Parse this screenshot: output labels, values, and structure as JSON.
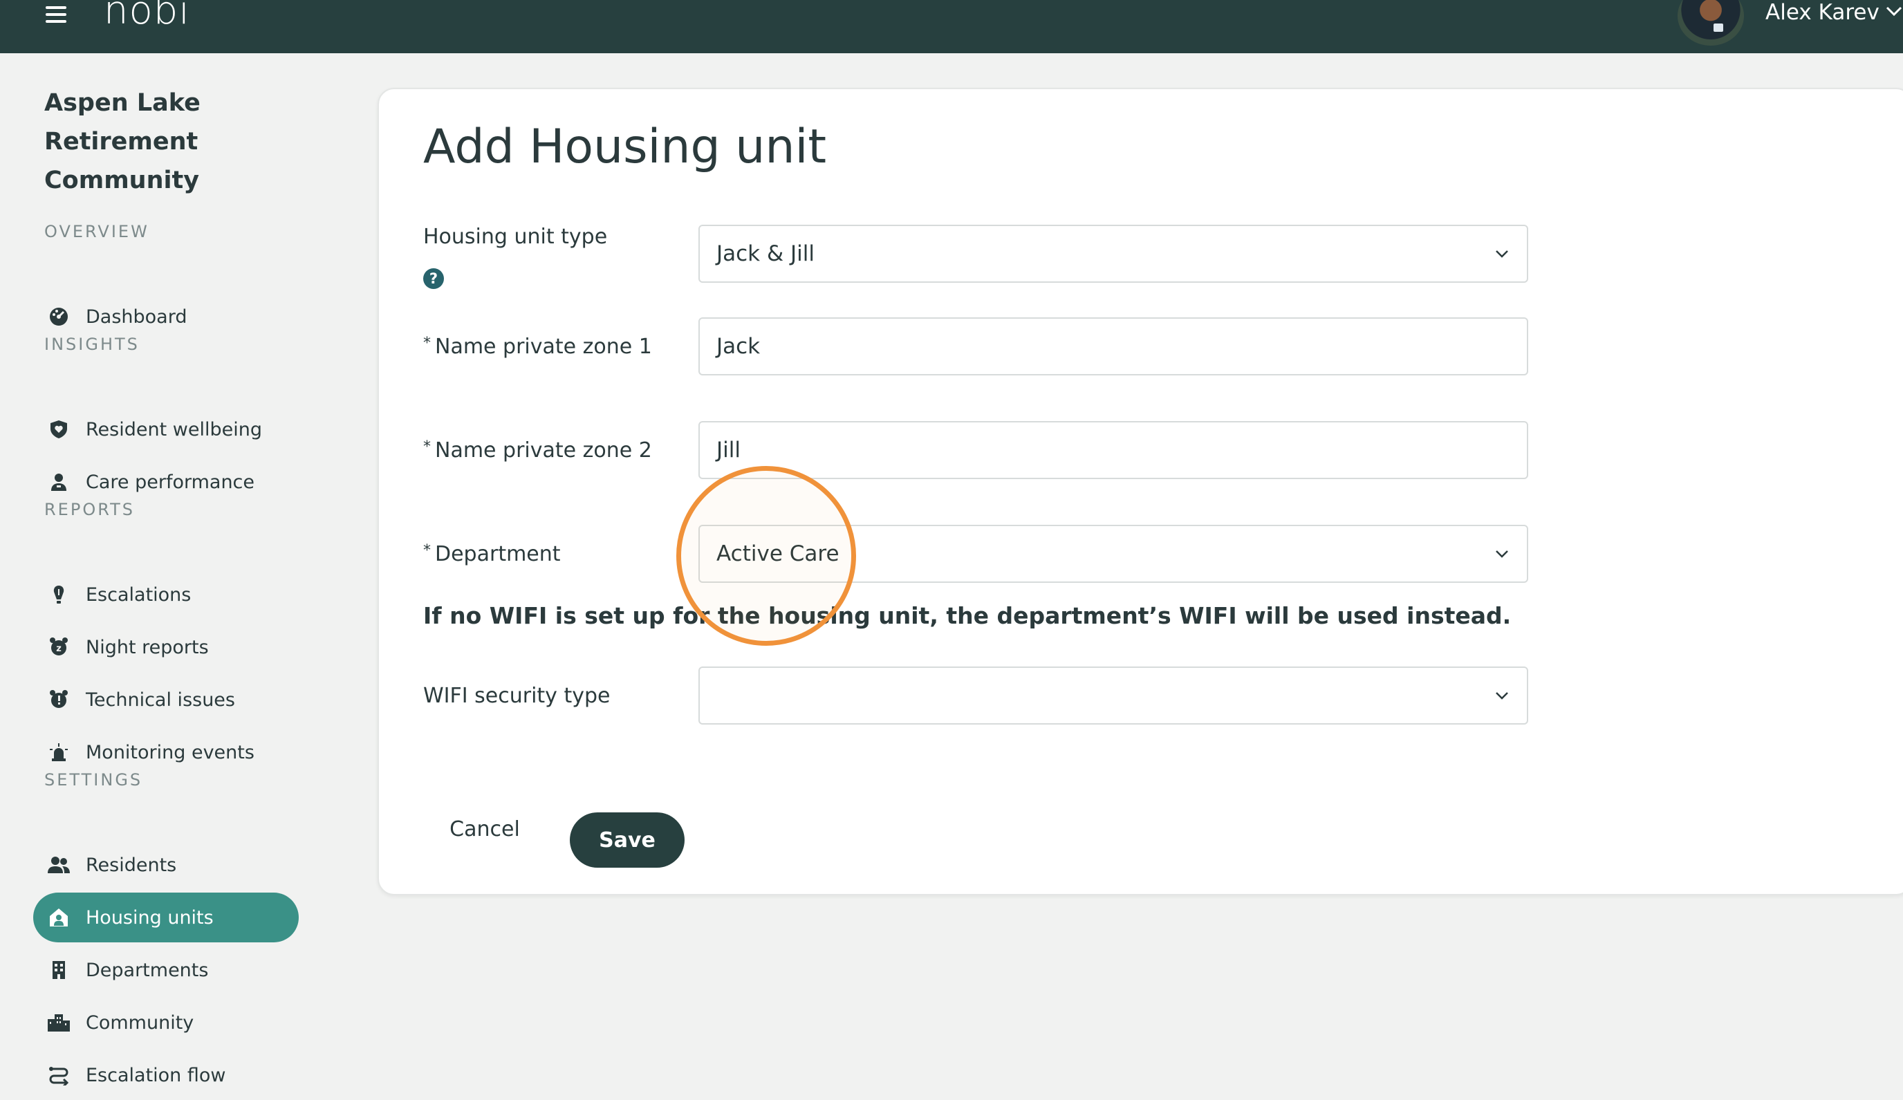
{
  "app": {
    "logo": "nobi"
  },
  "user": {
    "name": "Alex Karev"
  },
  "sidebar": {
    "community_name": "Aspen Lake Retirement Community",
    "sections": {
      "overview": "OVERVIEW",
      "insights": "INSIGHTS",
      "reports": "REPORTS",
      "settings": "SETTINGS"
    },
    "items": {
      "dashboard": "Dashboard",
      "resident_wellbeing": "Resident wellbeing",
      "care_performance": "Care performance",
      "escalations": "Escalations",
      "night_reports": "Night reports",
      "technical_issues": "Technical issues",
      "monitoring_events": "Monitoring events",
      "residents": "Residents",
      "housing_units": "Housing units",
      "departments": "Departments",
      "community": "Community",
      "escalation_flow": "Escalation flow"
    },
    "active_item": "housing_units"
  },
  "form": {
    "title": "Add Housing unit",
    "housing_unit_type": {
      "label": "Housing unit type",
      "value": "Jack & Jill",
      "help": "?"
    },
    "zone1": {
      "required_mark": "*",
      "label": "Name private zone 1",
      "value": "Jack"
    },
    "zone2": {
      "required_mark": "*",
      "label": "Name private zone 2",
      "value": "Jill"
    },
    "department": {
      "required_mark": "*",
      "label": "Department",
      "value": "Active Care"
    },
    "wifi_info": "If no WIFI is set up for the housing unit, the department’s WIFI will be used instead.",
    "wifi_security": {
      "label": "WIFI security type",
      "value": ""
    },
    "cancel_label": "Cancel",
    "save_label": "Save"
  },
  "colors": {
    "topbar": "#27403f",
    "accent": "#3a9187",
    "highlight": "#f0923a"
  }
}
